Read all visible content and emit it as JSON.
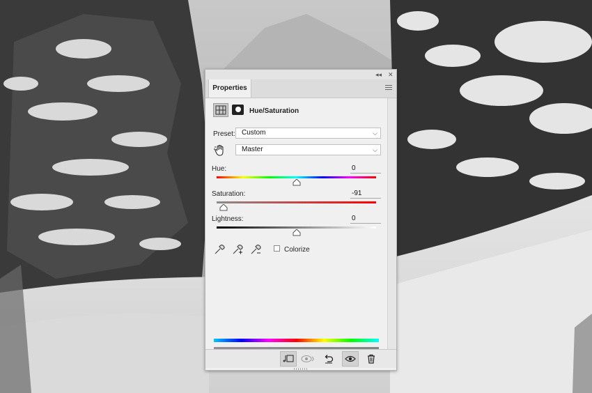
{
  "panel": {
    "tab_label": "Properties",
    "collapse_icon": "double-chevron-left-icon",
    "close_icon": "close-icon",
    "menu_icon": "hamburger-menu-icon"
  },
  "adjustment": {
    "title": "Hue/Saturation",
    "icon_adjustment": "hue-saturation-layer-icon",
    "icon_mask": "layer-mask-icon"
  },
  "preset": {
    "label": "Preset:",
    "value": "Custom"
  },
  "channel": {
    "value": "Master",
    "icon": "target-adjust-hand-icon"
  },
  "hue": {
    "label": "Hue:",
    "value": "0",
    "min": -180,
    "max": 180,
    "current": 0
  },
  "saturation": {
    "label": "Saturation:",
    "value": "-91",
    "min": -100,
    "max": 100,
    "current": -91
  },
  "lightness": {
    "label": "Lightness:",
    "value": "0",
    "min": -100,
    "max": 100,
    "current": 0
  },
  "eyedroppers": [
    "eyedropper-icon",
    "eyedropper-add-icon",
    "eyedropper-subtract-icon"
  ],
  "colorize": {
    "label": "Colorize",
    "checked": false
  },
  "bottom_toolbar": [
    "clip-to-layer-icon",
    "view-previous-state-icon",
    "reset-icon",
    "visibility-eye-icon",
    "trash-icon"
  ]
}
